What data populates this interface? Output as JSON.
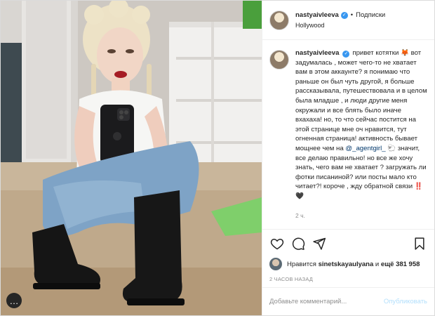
{
  "post": {
    "username": "nastyaivleeva",
    "follow_label": "Подписки",
    "separator": "•",
    "location": "Hollywood",
    "caption": {
      "part1": "привет котятки 🦊 вот задумалась , может чего-то не хватает вам в этом аккаунте? я понимаю что раньше он был чуть другой, я больше рассказывала, путешествовала и в целом была младше , и люди другие меня окружали и все блять было иначе вхахаха! но, то что сейчас постится на этой странице мне оч нравится, тут огненная страница! активность бывает мощнее чем на",
      "mention": "@_agentgirl_",
      "part2": "🐑 значит, все делаю правильно! но все же хочу знать, чего вам не хватает ? загружать ли фотки писаниной? или посты мало кто читает?! короче , жду обратной связи ‼️🖤"
    },
    "time_ago": "2 ч.",
    "likes": {
      "prefix": "Нравится",
      "liker": "sinetskayaulyana",
      "middle": "и",
      "others": "ещё 381 958"
    },
    "date": "2 ЧАСОВ НАЗАД",
    "comment": {
      "placeholder": "Добавьте комментарий...",
      "publish_label": "Опубликовать"
    }
  },
  "icons": {
    "heart": "heart-icon",
    "comment": "comment-icon",
    "share": "share-icon",
    "bookmark": "bookmark-icon",
    "more": "more-icon",
    "verified": "verified-badge-icon"
  },
  "colors": {
    "verified": "#3897f0",
    "link": "#00376b",
    "muted": "#8e8e8e",
    "publish_disabled": "#b2dffc"
  }
}
